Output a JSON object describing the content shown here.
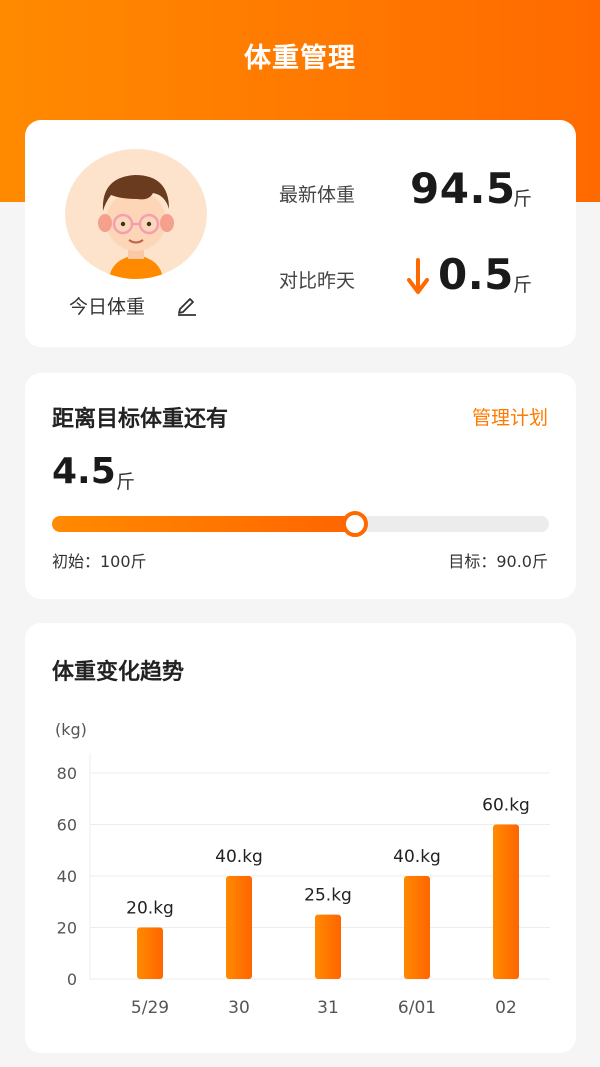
{
  "header": {
    "title": "体重管理",
    "bg_color_start": "#ff8a00",
    "bg_color_end": "#ff6a00"
  },
  "weight_card": {
    "today_label": "今日体重",
    "latest_label": "最新体重",
    "latest_value": "94.5",
    "latest_unit": "斤",
    "compare_label": "对比昨天",
    "compare_value": "0.5",
    "compare_unit": "斤",
    "compare_direction_icon": "arrow-down-icon",
    "edit_icon": "pencil-icon"
  },
  "goal_card": {
    "title": "距离目标体重还有",
    "manage_link": "管理计划",
    "remaining_value": "4.5",
    "remaining_unit": "斤",
    "progress_fraction": 0.61,
    "start_label": "初始：100斤",
    "target_label": "目标：90.0斤",
    "accent_color": "#ff7a00"
  },
  "trend_card": {
    "title": "体重变化趋势"
  },
  "chart_data": {
    "type": "bar",
    "ylabel": "(kg)",
    "ylim": [
      0,
      80
    ],
    "yticks": [
      0,
      20,
      40,
      60,
      80
    ],
    "categories": [
      "5/29",
      "30",
      "31",
      "6/01",
      "02"
    ],
    "values": [
      20,
      40,
      25,
      40,
      60
    ],
    "data_labels": [
      "20.kg",
      "40.kg",
      "25.kg",
      "40.kg",
      "60.kg"
    ],
    "grid": true,
    "bar_color": "#ff7a00"
  }
}
